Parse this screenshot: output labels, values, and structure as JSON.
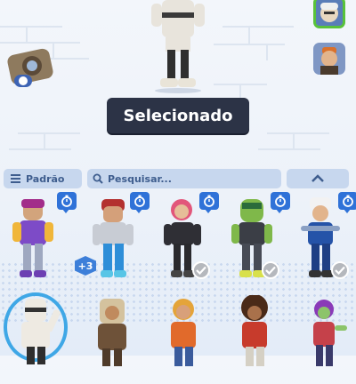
{
  "banner": {
    "selected_label": "Selecionado"
  },
  "toolbar": {
    "filter_label": "Padrão",
    "search_placeholder": "Pesquisar..."
  },
  "badges": {
    "plus_count": "+3"
  },
  "icons": {
    "camera": "camera-icon",
    "timer": "stopwatch-icon",
    "check": "check-icon",
    "filter": "list-icon",
    "search": "search-icon",
    "collapse": "chevron-up-icon"
  },
  "colors": {
    "banner_bg": "#2c3346",
    "selected_ring": "#3fa7e6",
    "selected_border": "#58c23a",
    "timer_bg": "#2f72d8",
    "toolbar_bg": "#c7d7ee"
  }
}
